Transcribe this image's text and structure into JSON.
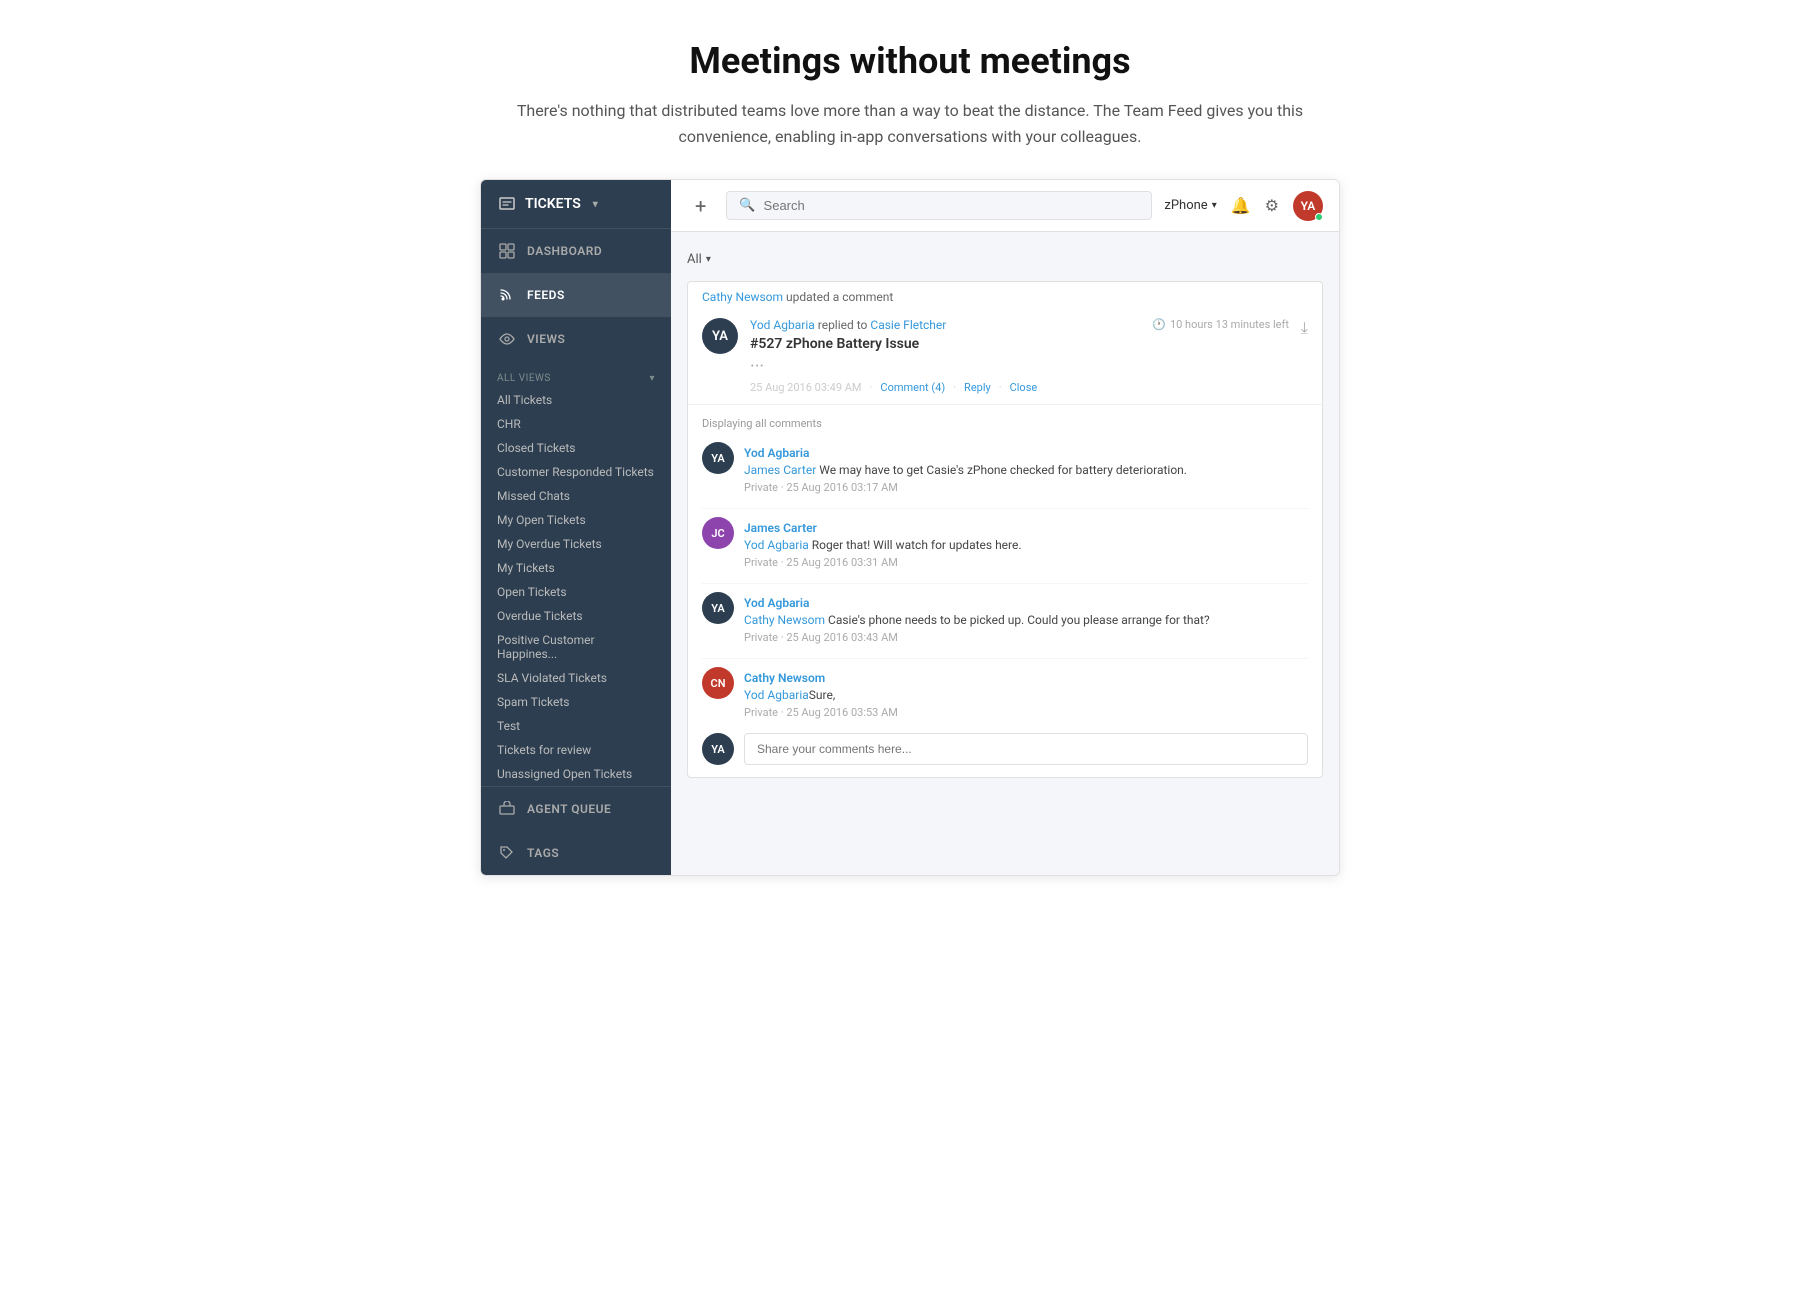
{
  "header": {
    "title": "Meetings without meetings",
    "subtitle": "There's nothing that distributed teams love more than a way to beat the distance. The Team Feed gives you this convenience, enabling in-app conversations with your colleagues."
  },
  "sidebar": {
    "tickets_label": "TICKETS",
    "dashboard_label": "DASHBOARD",
    "feeds_label": "FEEDS",
    "views_label": "VIEWS",
    "all_views_label": "ALL VIEWS",
    "list_items": [
      "All Tickets",
      "CHR",
      "Closed Tickets",
      "Customer Responded Tickets",
      "Missed Chats",
      "My Open Tickets",
      "My Overdue Tickets",
      "My Tickets",
      "Open Tickets",
      "Overdue Tickets",
      "Positive Customer Happines...",
      "SLA Violated Tickets",
      "Spam Tickets",
      "Test",
      "Tickets for review",
      "Unassigned Open Tickets"
    ],
    "agent_queue_label": "AGENT QUEUE",
    "tags_label": "TAGS"
  },
  "topbar": {
    "search_placeholder": "Search",
    "zphone_label": "zPhone",
    "add_label": "+"
  },
  "feed": {
    "filter_label": "All",
    "update_text": "updated a comment",
    "update_author": "Cathy Newsom",
    "ticket": {
      "replied_by": "Yod Agbaria",
      "replied_to": "Casie Fletcher",
      "subject": "#527 zPhone Battery Issue",
      "time_left": "10 hours 13 minutes left",
      "timestamp": "25 Aug 2016 03:49 AM",
      "comment_count": "Comment (4)",
      "reply_label": "Reply",
      "close_label": "Close"
    },
    "comments_label": "Displaying all comments",
    "comments": [
      {
        "author": "Yod Agbaria",
        "mention": "James Carter",
        "text": " We may have to get Casie's zPhone checked for battery deterioration.",
        "privacy": "Private",
        "timestamp": "25 Aug 2016 03:17 AM",
        "avatar_color": "#2c3e50",
        "avatar_initials": "YA"
      },
      {
        "author": "James Carter",
        "mention": "Yod Agbaria",
        "text": " Roger that! Will watch for updates here.",
        "privacy": "Private",
        "timestamp": "25 Aug 2016 03:31 AM",
        "avatar_color": "#8e44ad",
        "avatar_initials": "JC"
      },
      {
        "author": "Yod Agbaria",
        "mention": "Cathy Newsom",
        "text": " Casie's phone needs to be picked up. Could you please arrange for that?",
        "privacy": "Private",
        "timestamp": "25 Aug 2016 03:43 AM",
        "avatar_color": "#2c3e50",
        "avatar_initials": "YA"
      },
      {
        "author": "Cathy Newsom",
        "mention": "Yod Agbaria",
        "text": "Sure, ",
        "text_after": "",
        "privacy": "Private",
        "timestamp": "25 Aug 2016 03:53 AM",
        "avatar_color": "#c0392b",
        "avatar_initials": "CN"
      }
    ],
    "comment_input_placeholder": "Share your comments here..."
  }
}
